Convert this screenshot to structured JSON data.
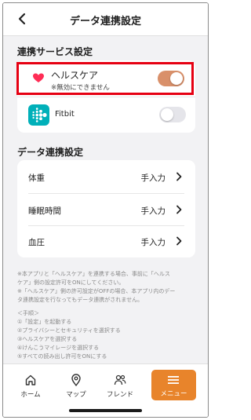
{
  "header": {
    "title": "データ連携設定"
  },
  "services": {
    "section_title": "連携サービス設定",
    "health": {
      "name": "ヘルスケア",
      "note": "※無効にできません",
      "enabled": true
    },
    "fitbit": {
      "name": "Fitbit",
      "enabled": false
    }
  },
  "data_settings": {
    "section_title": "データ連携設定",
    "rows": [
      {
        "label": "体重",
        "value": "手入力"
      },
      {
        "label": "睡眠時間",
        "value": "手入力"
      },
      {
        "label": "血圧",
        "value": "手入力"
      }
    ]
  },
  "notes": {
    "line1": "※本アプリと「ヘルスケア」を連携する場合、事前に「ヘルス",
    "line2": "ケア」側の設定許可をONにしてください。",
    "line3": "※「ヘルスケア」側の許可設定がOFFの場合、本アプリ内のデー",
    "line4": "タ連携設定を行なってもデータ連携がされません。",
    "steps_title": "＜手順＞",
    "step1": "①「設定」を起動する",
    "step2": "②プライバシーとセキュリティを選択する",
    "step3": "③ヘルスケアを選択する",
    "step4": "④けんこうマイレージを選択する",
    "step5": "⑤すべての読み出し許可をONにする"
  },
  "tabbar": {
    "home": "ホーム",
    "map": "マップ",
    "friends": "フレンド",
    "menu": "メニュー"
  },
  "colors": {
    "accent": "#e8842b",
    "highlight": "#e60012",
    "toggle_on": "#d9906a",
    "toggle_off": "#e5e5ea",
    "fitbit": "#00b0b9",
    "heart": "#ff2d55"
  }
}
